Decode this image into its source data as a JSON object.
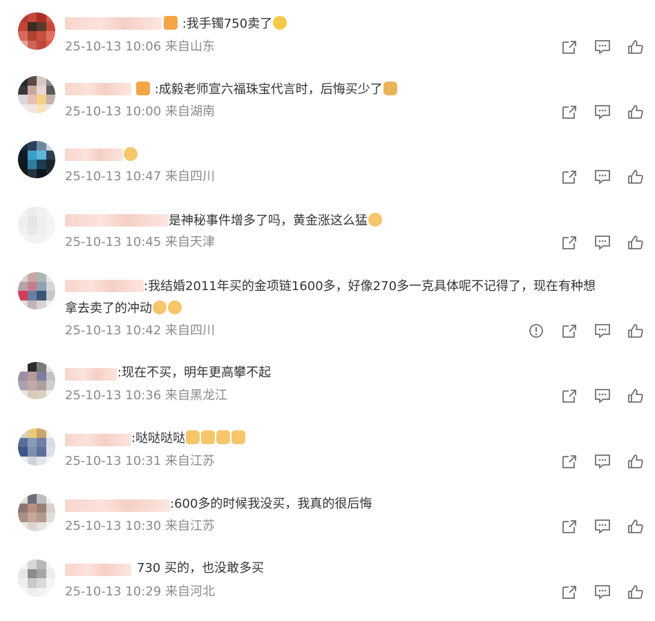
{
  "comments": [
    {
      "text": ":我手镯750卖了",
      "time": "25-10-13 10:06",
      "location": "来自山东",
      "emoji": "cry-laugh-icon",
      "report": false
    },
    {
      "text": ":成毅老师宣六福珠宝代言时，后悔买少了",
      "time": "25-10-13 10:00",
      "location": "来自湖南",
      "emoji": "sitting-person-icon",
      "report": false
    },
    {
      "text": "",
      "time": "25-10-13 10:47",
      "location": "来自四川",
      "emoji": "doge-icon",
      "report": false
    },
    {
      "text": "是神秘事件增多了吗，黄金涨这么猛",
      "time": "25-10-13 10:45",
      "location": "来自天津",
      "emoji": "doge-icon",
      "report": false
    },
    {
      "text_line1": ":我结婚2011年买的金项链1600多，好像270多一克具体呢不记得了，现在有种想",
      "text_line2": "拿去卖了的冲动",
      "time": "25-10-13 10:42",
      "location": "来自四川",
      "emoji": "doge-icon",
      "report": true
    },
    {
      "text": ":现在不买，明年更高攀不起",
      "time": "25-10-13 10:36",
      "location": "来自黑龙江",
      "report": false
    },
    {
      "text": ":哒哒哒哒",
      "time": "25-10-13 10:31",
      "location": "来自江苏",
      "emoji": "thumbs-up-emoji-icon",
      "report": false
    },
    {
      "text": ":600多的时候我没买，我真的很后悔",
      "time": "25-10-13 10:30",
      "location": "来自江苏",
      "report": false
    },
    {
      "text": "730 买的，也没敢多买",
      "time": "25-10-13 10:29",
      "location": "来自河北",
      "report": false
    }
  ],
  "colors": {
    "text": "#333333",
    "meta": "#8a8a8a",
    "icon": "#6f6f6f",
    "emoji": "#f5b93a"
  }
}
